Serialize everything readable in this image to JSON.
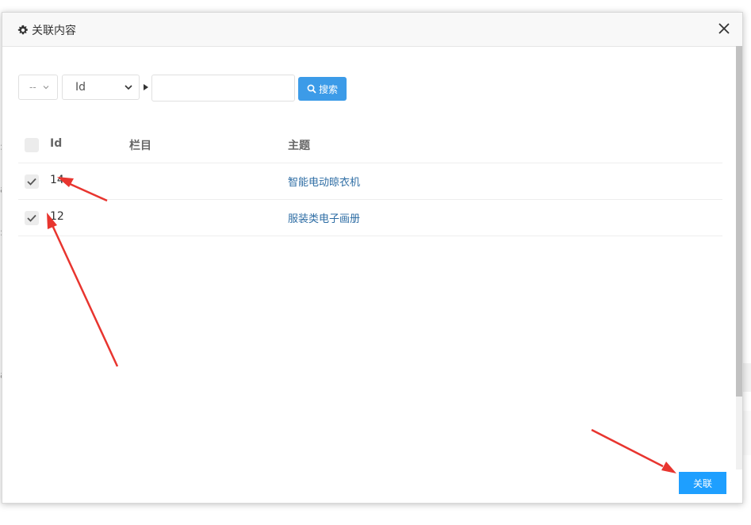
{
  "modal": {
    "title": "关联内容",
    "title_icon": "gear-icon",
    "close_icon": "close-icon"
  },
  "toolbar": {
    "operator_value": "--",
    "field_value": "Id",
    "search_value": "",
    "search_label": "搜索"
  },
  "table": {
    "headers": {
      "id": "Id",
      "column": "栏目",
      "topic": "主题"
    },
    "rows": [
      {
        "id": "14",
        "column": "",
        "topic": "智能电动晾衣机",
        "checked": true
      },
      {
        "id": "12",
        "column": "",
        "topic": "服装类电子画册",
        "checked": true
      }
    ]
  },
  "footer": {
    "confirm_label": "关联"
  },
  "colors": {
    "accent": "#1e9fff",
    "search_button": "#3c9be8",
    "link": "#2e6da4",
    "annotation_arrow": "#e8352f"
  }
}
